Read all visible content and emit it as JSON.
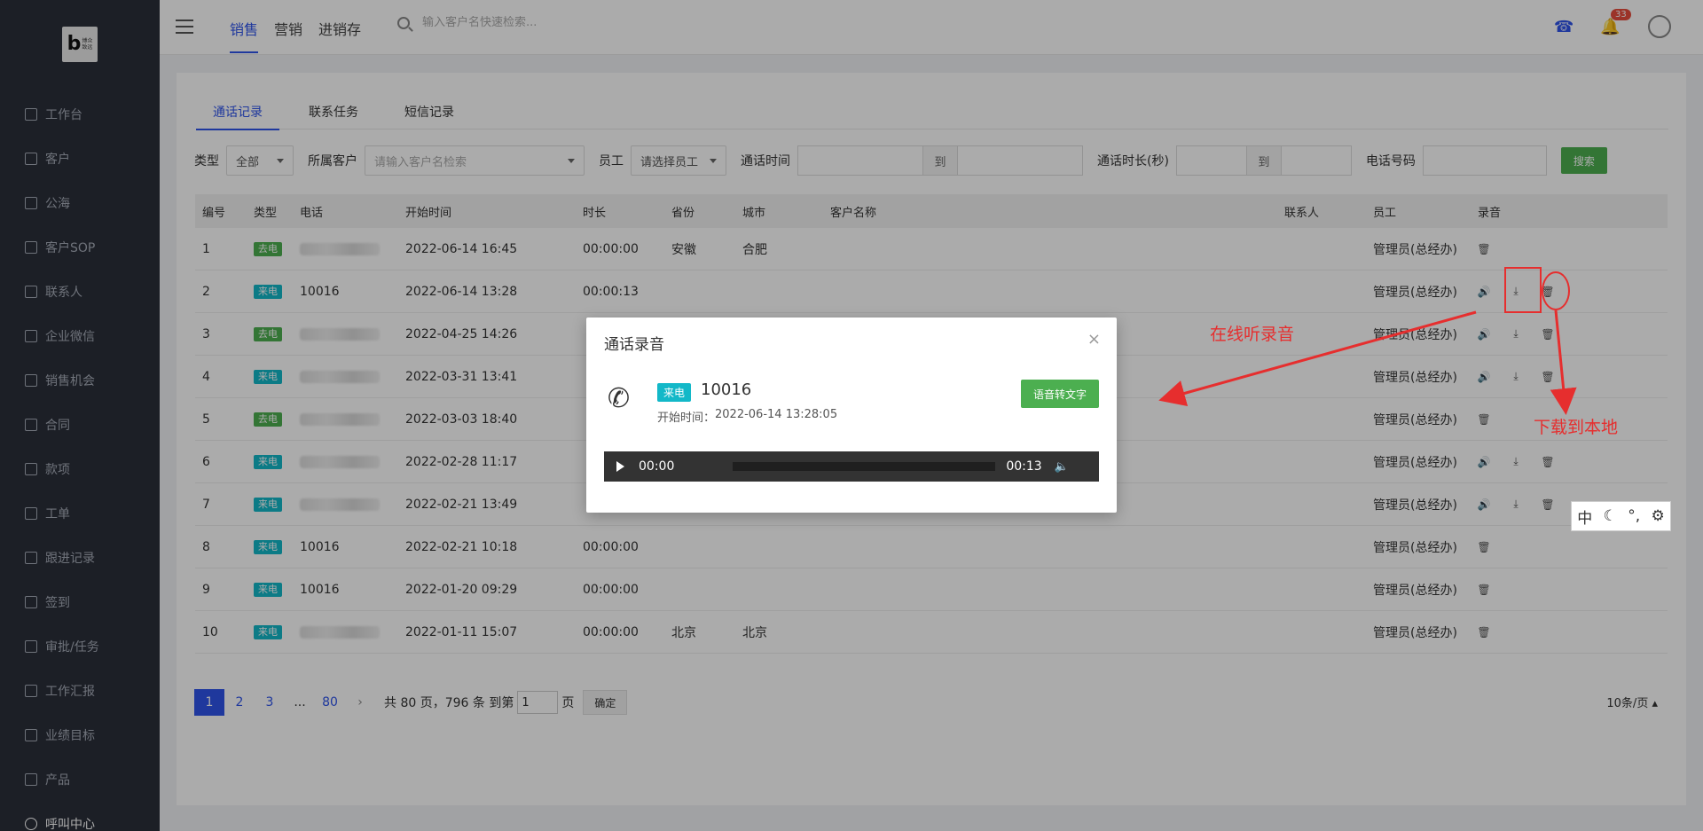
{
  "sidebar": {
    "items": [
      {
        "label": "工作台"
      },
      {
        "label": "客户"
      },
      {
        "label": "公海"
      },
      {
        "label": "客户SOP"
      },
      {
        "label": "联系人"
      },
      {
        "label": "企业微信"
      },
      {
        "label": "销售机会"
      },
      {
        "label": "合同"
      },
      {
        "label": "款项"
      },
      {
        "label": "工单"
      },
      {
        "label": "跟进记录"
      },
      {
        "label": "签到"
      },
      {
        "label": "审批/任务"
      },
      {
        "label": "工作汇报"
      },
      {
        "label": "业绩目标"
      },
      {
        "label": "产品"
      },
      {
        "label": "呼叫中心",
        "active": true
      }
    ],
    "logo": {
      "letter": "b",
      "text": "博众致远"
    }
  },
  "topbar": {
    "nav": [
      {
        "label": "销售",
        "active": true
      },
      {
        "label": "营销"
      },
      {
        "label": "进销存"
      }
    ],
    "search_placeholder": "输入客户名快速检索...",
    "notification_count": "33"
  },
  "tabs": [
    {
      "label": "通话记录",
      "active": true
    },
    {
      "label": "联系任务"
    },
    {
      "label": "短信记录"
    }
  ],
  "filters": {
    "type_label": "类型",
    "type_value": "全部",
    "customer_label": "所属客户",
    "customer_placeholder": "请输入客户名检索",
    "employee_label": "员工",
    "employee_value": "请选择员工",
    "time_label": "通话时间",
    "to": "到",
    "duration_label": "通话时长(秒)",
    "phone_label": "电话号码",
    "search_button": "搜索"
  },
  "table": {
    "headers": {
      "no": "编号",
      "type": "类型",
      "phone": "电话",
      "start": "开始时间",
      "duration": "时长",
      "province": "省份",
      "city": "城市",
      "customer": "客户名称",
      "contact": "联系人",
      "employee": "员工",
      "recording": "录音"
    },
    "rows": [
      {
        "no": "1",
        "type": "去电",
        "phone": "",
        "start": "2022-06-14 16:45",
        "duration": "00:00:00",
        "province": "安徽",
        "city": "合肥",
        "employee": "管理员(总经办)"
      },
      {
        "no": "2",
        "type": "来电",
        "phone": "10016",
        "start": "2022-06-14 13:28",
        "duration": "00:00:13",
        "province": "",
        "city": "",
        "employee": "管理员(总经办)"
      },
      {
        "no": "3",
        "type": "去电",
        "phone": "",
        "start": "2022-04-25 14:26",
        "duration": "",
        "province": "",
        "city": "",
        "employee": "管理员(总经办)"
      },
      {
        "no": "4",
        "type": "来电",
        "phone": "",
        "start": "2022-03-31 13:41",
        "duration": "",
        "province": "",
        "city": "",
        "employee": "管理员(总经办)"
      },
      {
        "no": "5",
        "type": "去电",
        "phone": "",
        "start": "2022-03-03 18:40",
        "duration": "",
        "province": "",
        "city": "",
        "employee": "管理员(总经办)"
      },
      {
        "no": "6",
        "type": "来电",
        "phone": "",
        "start": "2022-02-28 11:17",
        "duration": "",
        "province": "",
        "city": "",
        "employee": "管理员(总经办)"
      },
      {
        "no": "7",
        "type": "来电",
        "phone": "",
        "start": "2022-02-21 13:49",
        "duration": "",
        "province": "",
        "city": "",
        "employee": "管理员(总经办)"
      },
      {
        "no": "8",
        "type": "来电",
        "phone": "10016",
        "start": "2022-02-21 10:18",
        "duration": "00:00:00",
        "province": "",
        "city": "",
        "employee": "管理员(总经办)"
      },
      {
        "no": "9",
        "type": "来电",
        "phone": "10016",
        "start": "2022-01-20 09:29",
        "duration": "00:00:00",
        "province": "",
        "city": "",
        "employee": "管理员(总经办)"
      },
      {
        "no": "10",
        "type": "来电",
        "phone": "",
        "start": "2022-01-11 15:07",
        "duration": "00:00:00",
        "province": "北京",
        "city": "北京",
        "employee": "管理员(总经办)"
      }
    ]
  },
  "pager": {
    "pages": [
      "1",
      "2",
      "3",
      "...",
      "80"
    ],
    "summary": "共 80 页，796 条 到第",
    "page_input": "1",
    "page_suffix": "页",
    "confirm": "确定",
    "page_size": "10条/页"
  },
  "modal": {
    "title": "通话录音",
    "tag": "来电",
    "number": "10016",
    "start_label": "开始时间：",
    "start_value": "2022-06-14 13:28:05",
    "convert_button": "语音转文字",
    "current_time": "00:00",
    "total_time": "00:13",
    "progress": 0
  },
  "annotations": {
    "listen_online": "在线听录音",
    "download_local": "下载到本地"
  },
  "ime": {
    "lang": "中"
  }
}
